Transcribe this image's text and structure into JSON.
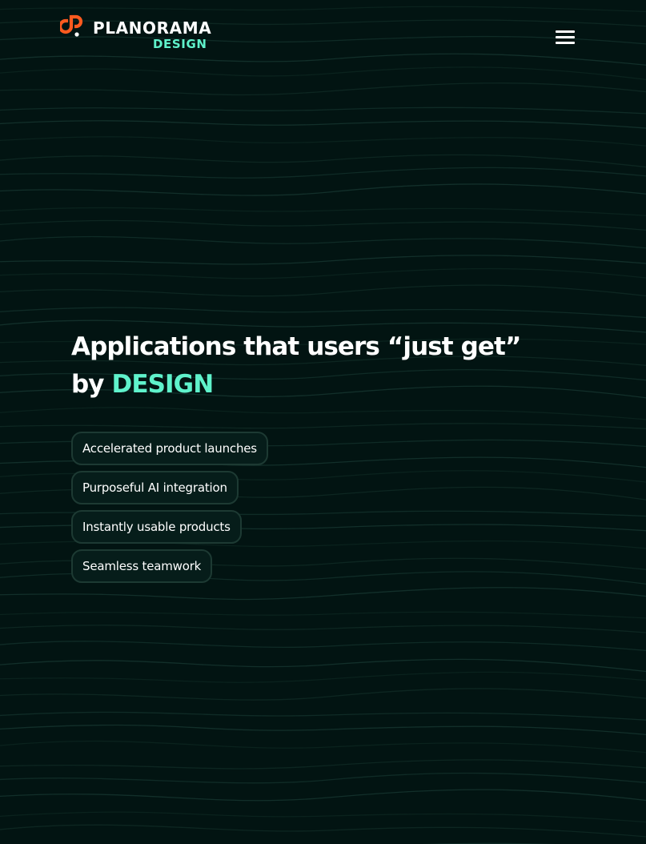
{
  "brand": {
    "name": "PLANORAMA",
    "tagline": "DESIGN",
    "colors": {
      "background": "#021412",
      "accent": "#5ff2cb",
      "logo_mark": "#ff5a1f",
      "text": "#ffffff"
    }
  },
  "header": {
    "menu_icon": "hamburger-menu-icon"
  },
  "hero": {
    "headline_line1": "Applications that users “just get”",
    "headline_by": "by",
    "headline_accent": "DESIGN"
  },
  "features": [
    {
      "label": "Accelerated product launches"
    },
    {
      "label": "Purposeful AI integration"
    },
    {
      "label": "Instantly usable products"
    },
    {
      "label": "Seamless teamwork"
    }
  ]
}
